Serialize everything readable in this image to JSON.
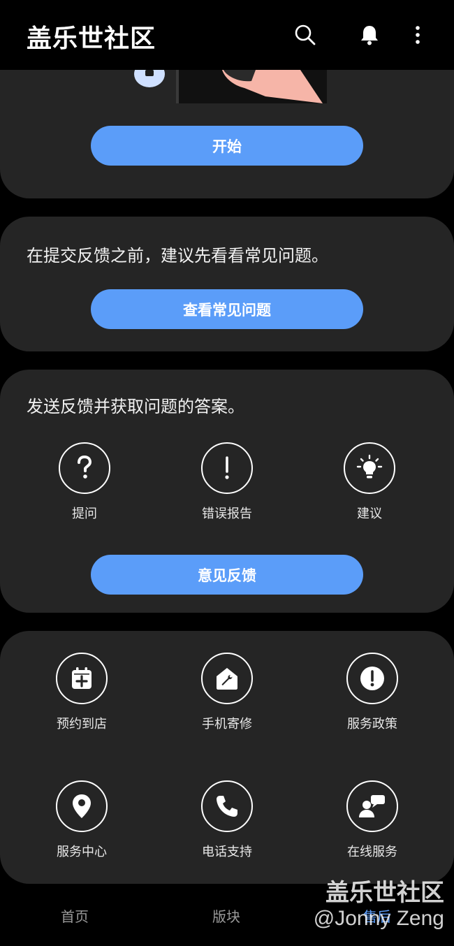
{
  "app": {
    "title": "盖乐世社区"
  },
  "hero_card": {
    "start_label": "开始"
  },
  "faq_card": {
    "text": "在提交反馈之前，建议先看看常见问题。",
    "button_label": "查看常见问题"
  },
  "feedback_card": {
    "text": "发送反馈并获取问题的答案。",
    "options": [
      {
        "label": "提问",
        "icon": "question-icon"
      },
      {
        "label": "错误报告",
        "icon": "exclamation-icon"
      },
      {
        "label": "建议",
        "icon": "lightbulb-icon"
      }
    ],
    "button_label": "意见反馈"
  },
  "service_card": {
    "items": [
      {
        "label": "预约到店",
        "icon": "calendar-add-icon"
      },
      {
        "label": "手机寄修",
        "icon": "wrench-house-icon"
      },
      {
        "label": "服务政策",
        "icon": "alert-circle-icon"
      },
      {
        "label": "服务中心",
        "icon": "location-pin-icon"
      },
      {
        "label": "电话支持",
        "icon": "phone-icon"
      },
      {
        "label": "在线服务",
        "icon": "chat-agent-icon"
      }
    ]
  },
  "bottom_nav": {
    "items": [
      {
        "label": "首页"
      },
      {
        "label": "版块"
      },
      {
        "label": "售后",
        "active": true
      }
    ]
  },
  "watermark": {
    "line1": "盖乐世社区",
    "line2": "@Jonny Zeng"
  },
  "colors": {
    "accent": "#5b9df9",
    "card": "#252525",
    "background": "#000000"
  }
}
